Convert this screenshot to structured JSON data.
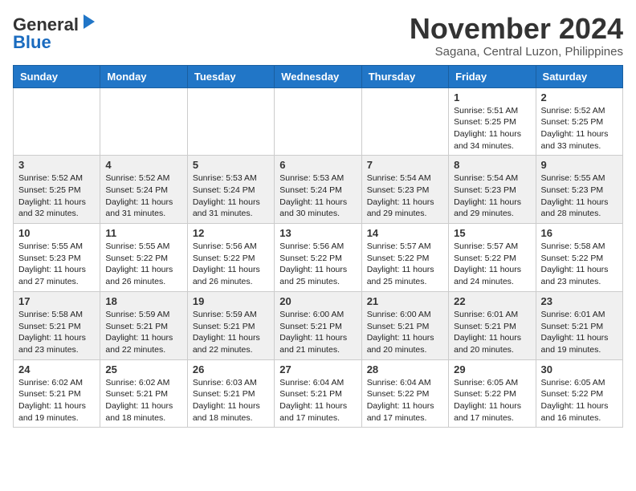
{
  "header": {
    "logo_general": "General",
    "logo_blue": "Blue",
    "month_title": "November 2024",
    "location": "Sagana, Central Luzon, Philippines"
  },
  "weekdays": [
    "Sunday",
    "Monday",
    "Tuesday",
    "Wednesday",
    "Thursday",
    "Friday",
    "Saturday"
  ],
  "weeks": [
    [
      {
        "day": "",
        "info": ""
      },
      {
        "day": "",
        "info": ""
      },
      {
        "day": "",
        "info": ""
      },
      {
        "day": "",
        "info": ""
      },
      {
        "day": "",
        "info": ""
      },
      {
        "day": "1",
        "info": "Sunrise: 5:51 AM\nSunset: 5:25 PM\nDaylight: 11 hours\nand 34 minutes."
      },
      {
        "day": "2",
        "info": "Sunrise: 5:52 AM\nSunset: 5:25 PM\nDaylight: 11 hours\nand 33 minutes."
      }
    ],
    [
      {
        "day": "3",
        "info": "Sunrise: 5:52 AM\nSunset: 5:25 PM\nDaylight: 11 hours\nand 32 minutes."
      },
      {
        "day": "4",
        "info": "Sunrise: 5:52 AM\nSunset: 5:24 PM\nDaylight: 11 hours\nand 31 minutes."
      },
      {
        "day": "5",
        "info": "Sunrise: 5:53 AM\nSunset: 5:24 PM\nDaylight: 11 hours\nand 31 minutes."
      },
      {
        "day": "6",
        "info": "Sunrise: 5:53 AM\nSunset: 5:24 PM\nDaylight: 11 hours\nand 30 minutes."
      },
      {
        "day": "7",
        "info": "Sunrise: 5:54 AM\nSunset: 5:23 PM\nDaylight: 11 hours\nand 29 minutes."
      },
      {
        "day": "8",
        "info": "Sunrise: 5:54 AM\nSunset: 5:23 PM\nDaylight: 11 hours\nand 29 minutes."
      },
      {
        "day": "9",
        "info": "Sunrise: 5:55 AM\nSunset: 5:23 PM\nDaylight: 11 hours\nand 28 minutes."
      }
    ],
    [
      {
        "day": "10",
        "info": "Sunrise: 5:55 AM\nSunset: 5:23 PM\nDaylight: 11 hours\nand 27 minutes."
      },
      {
        "day": "11",
        "info": "Sunrise: 5:55 AM\nSunset: 5:22 PM\nDaylight: 11 hours\nand 26 minutes."
      },
      {
        "day": "12",
        "info": "Sunrise: 5:56 AM\nSunset: 5:22 PM\nDaylight: 11 hours\nand 26 minutes."
      },
      {
        "day": "13",
        "info": "Sunrise: 5:56 AM\nSunset: 5:22 PM\nDaylight: 11 hours\nand 25 minutes."
      },
      {
        "day": "14",
        "info": "Sunrise: 5:57 AM\nSunset: 5:22 PM\nDaylight: 11 hours\nand 25 minutes."
      },
      {
        "day": "15",
        "info": "Sunrise: 5:57 AM\nSunset: 5:22 PM\nDaylight: 11 hours\nand 24 minutes."
      },
      {
        "day": "16",
        "info": "Sunrise: 5:58 AM\nSunset: 5:22 PM\nDaylight: 11 hours\nand 23 minutes."
      }
    ],
    [
      {
        "day": "17",
        "info": "Sunrise: 5:58 AM\nSunset: 5:21 PM\nDaylight: 11 hours\nand 23 minutes."
      },
      {
        "day": "18",
        "info": "Sunrise: 5:59 AM\nSunset: 5:21 PM\nDaylight: 11 hours\nand 22 minutes."
      },
      {
        "day": "19",
        "info": "Sunrise: 5:59 AM\nSunset: 5:21 PM\nDaylight: 11 hours\nand 22 minutes."
      },
      {
        "day": "20",
        "info": "Sunrise: 6:00 AM\nSunset: 5:21 PM\nDaylight: 11 hours\nand 21 minutes."
      },
      {
        "day": "21",
        "info": "Sunrise: 6:00 AM\nSunset: 5:21 PM\nDaylight: 11 hours\nand 20 minutes."
      },
      {
        "day": "22",
        "info": "Sunrise: 6:01 AM\nSunset: 5:21 PM\nDaylight: 11 hours\nand 20 minutes."
      },
      {
        "day": "23",
        "info": "Sunrise: 6:01 AM\nSunset: 5:21 PM\nDaylight: 11 hours\nand 19 minutes."
      }
    ],
    [
      {
        "day": "24",
        "info": "Sunrise: 6:02 AM\nSunset: 5:21 PM\nDaylight: 11 hours\nand 19 minutes."
      },
      {
        "day": "25",
        "info": "Sunrise: 6:02 AM\nSunset: 5:21 PM\nDaylight: 11 hours\nand 18 minutes."
      },
      {
        "day": "26",
        "info": "Sunrise: 6:03 AM\nSunset: 5:21 PM\nDaylight: 11 hours\nand 18 minutes."
      },
      {
        "day": "27",
        "info": "Sunrise: 6:04 AM\nSunset: 5:21 PM\nDaylight: 11 hours\nand 17 minutes."
      },
      {
        "day": "28",
        "info": "Sunrise: 6:04 AM\nSunset: 5:22 PM\nDaylight: 11 hours\nand 17 minutes."
      },
      {
        "day": "29",
        "info": "Sunrise: 6:05 AM\nSunset: 5:22 PM\nDaylight: 11 hours\nand 17 minutes."
      },
      {
        "day": "30",
        "info": "Sunrise: 6:05 AM\nSunset: 5:22 PM\nDaylight: 11 hours\nand 16 minutes."
      }
    ]
  ]
}
